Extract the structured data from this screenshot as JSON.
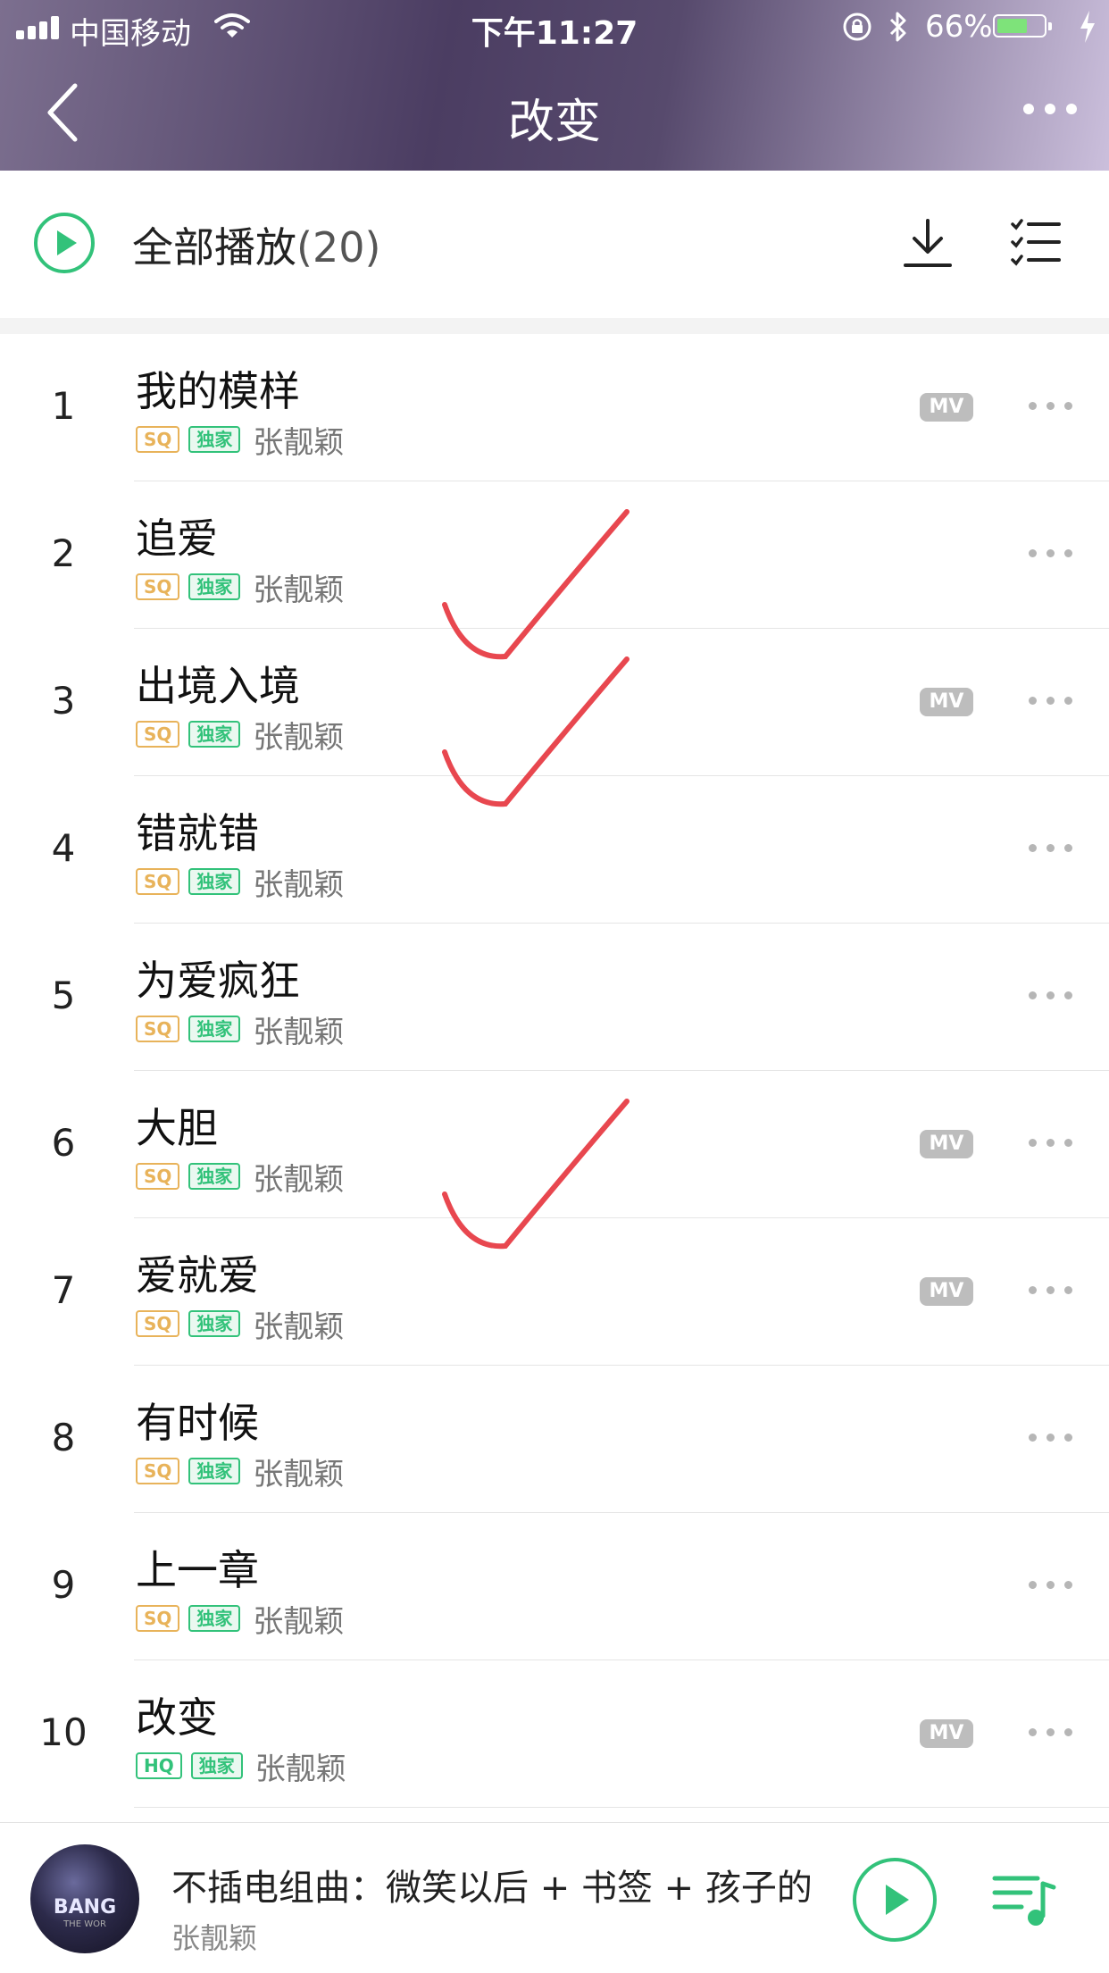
{
  "status_bar": {
    "carrier": "中国移动",
    "time": "下午11:27",
    "battery": "66%",
    "battery_level": 0.66,
    "icons": [
      "signal-icon",
      "wifi-icon",
      "orientation-lock-icon",
      "bluetooth-icon",
      "battery-icon",
      "charging-icon"
    ]
  },
  "nav": {
    "title": "改变",
    "icons": [
      "back-icon",
      "more-icon"
    ]
  },
  "play_all": {
    "label": "全部播放",
    "count": "(20)",
    "icons": [
      "play-circle-icon",
      "download-icon",
      "multi-select-icon"
    ]
  },
  "songs": [
    {
      "num": "1",
      "title": "我的模样",
      "quality": "SQ",
      "exclusive": "独家",
      "artist": "张靓颖",
      "mv": "MV",
      "checked": false
    },
    {
      "num": "2",
      "title": "追爱",
      "quality": "SQ",
      "exclusive": "独家",
      "artist": "张靓颖",
      "mv": "",
      "checked": true
    },
    {
      "num": "3",
      "title": "出境入境",
      "quality": "SQ",
      "exclusive": "独家",
      "artist": "张靓颖",
      "mv": "MV",
      "checked": true
    },
    {
      "num": "4",
      "title": "错就错",
      "quality": "SQ",
      "exclusive": "独家",
      "artist": "张靓颖",
      "mv": "",
      "checked": false
    },
    {
      "num": "5",
      "title": "为爱疯狂",
      "quality": "SQ",
      "exclusive": "独家",
      "artist": "张靓颖",
      "mv": "",
      "checked": false
    },
    {
      "num": "6",
      "title": "大胆",
      "quality": "SQ",
      "exclusive": "独家",
      "artist": "张靓颖",
      "mv": "MV",
      "checked": true
    },
    {
      "num": "7",
      "title": "爱就爱",
      "quality": "SQ",
      "exclusive": "独家",
      "artist": "张靓颖",
      "mv": "MV",
      "checked": false
    },
    {
      "num": "8",
      "title": "有时候",
      "quality": "SQ",
      "exclusive": "独家",
      "artist": "张靓颖",
      "mv": "",
      "checked": false
    },
    {
      "num": "9",
      "title": "上一章",
      "quality": "SQ",
      "exclusive": "独家",
      "artist": "张靓颖",
      "mv": "",
      "checked": false
    },
    {
      "num": "10",
      "title": "改变",
      "quality": "HQ",
      "exclusive": "独家",
      "artist": "张靓颖",
      "mv": "MV",
      "checked": false
    }
  ],
  "player": {
    "title": "不插电组曲：微笑以后 + 书签 + 孩子的",
    "artist": "张靓颖",
    "cover_text": "BANG",
    "cover_sub": "THE WOR",
    "icons": [
      "play-icon",
      "playlist-icon"
    ]
  },
  "colors": {
    "accent": "#32c27a",
    "sq_tag": "#e8b35a",
    "mv_badge": "#bdbdbd",
    "check_mark": "#e8474f",
    "header_gradient": [
      "#7c6f8f",
      "#4b3d62",
      "#cbbfdc"
    ]
  }
}
